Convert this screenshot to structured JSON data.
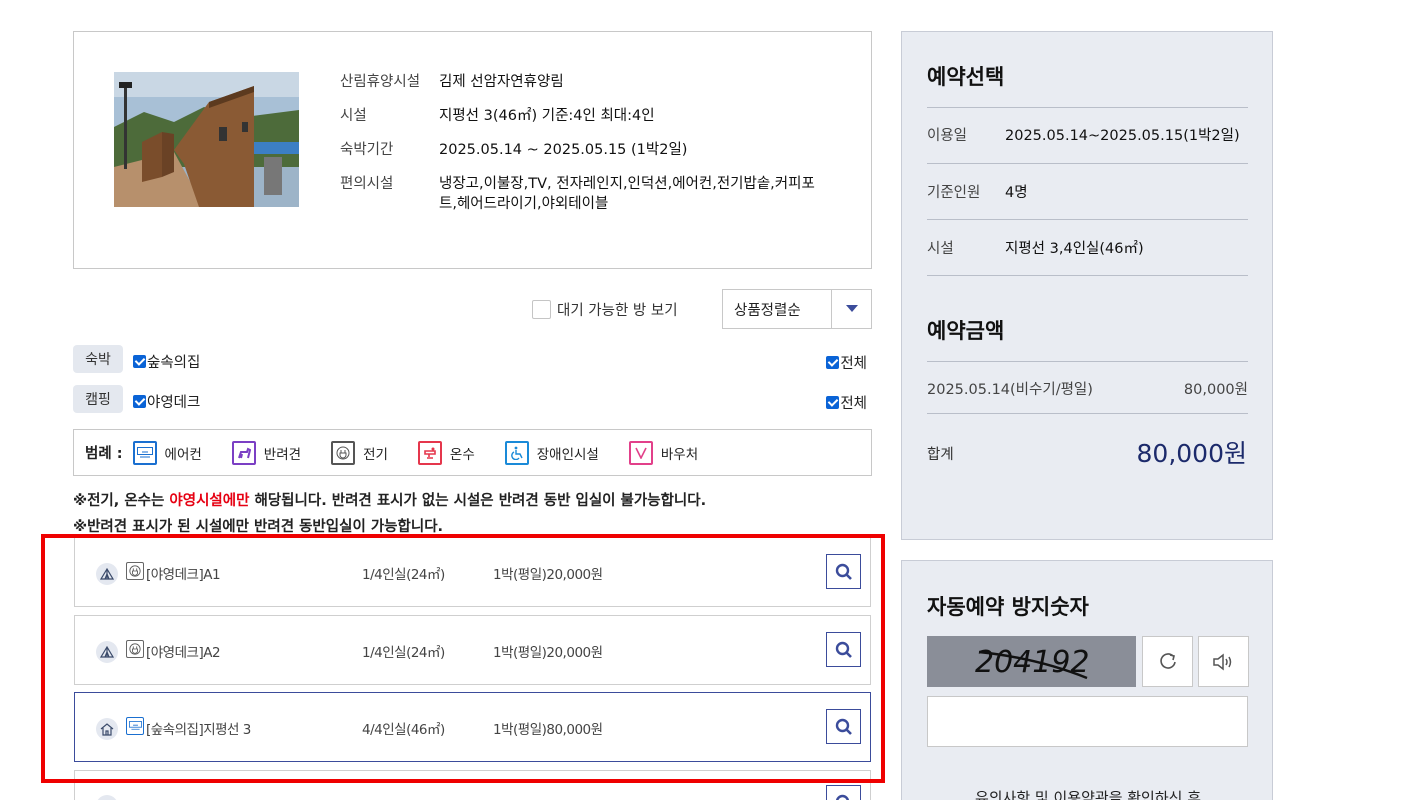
{
  "facility": {
    "rows": [
      {
        "label": "산림휴양시설",
        "value": "김제 선암자연휴양림"
      },
      {
        "label": "시설",
        "value": "지평선 3(46㎡) 기준:4인 최대:4인"
      },
      {
        "label": "숙박기간",
        "value": "2025.05.14 ~ 2025.05.15 (1박2일)"
      },
      {
        "label": "편의시설",
        "value": "냉장고,이불장,TV, 전자레인지,인덕션,에어컨,전기밥솥,커피포트,헤어드라이기,야외테이블"
      }
    ]
  },
  "toolbar": {
    "wait_label": "대기 가능한 방 보기",
    "sort_value": "상품정렬순"
  },
  "categories": [
    {
      "tag": "숙박",
      "option": "숲속의집",
      "all": "전체"
    },
    {
      "tag": "캠핑",
      "option": "야영데크",
      "all": "전체"
    }
  ],
  "legend": {
    "title": "범례 :",
    "items": [
      {
        "label": "에어컨",
        "icon": "aircon-icon",
        "color": "#1a6fd0"
      },
      {
        "label": "반려견",
        "icon": "pet-icon",
        "color": "#7b3fc4"
      },
      {
        "label": "전기",
        "icon": "electric-icon",
        "color": "#555555"
      },
      {
        "label": "온수",
        "icon": "hot-water-icon",
        "color": "#e5364c"
      },
      {
        "label": "장애인시설",
        "icon": "accessibility-icon",
        "color": "#1a8ad8"
      },
      {
        "label": "바우처",
        "icon": "voucher-icon",
        "color": "#e2408a"
      }
    ]
  },
  "notice": {
    "line1_prefix": "※전기, 온수는 ",
    "line1_red": "야영시설에만",
    "line1_suffix": " 해당됩니다. 반려견 표시가 없는 시설은 반려견 동반 입실이 불가능합니다.",
    "line2": "※반려견 표시가 된 시설에만 반려견 동반입실이 가능합니다."
  },
  "rooms": [
    {
      "name": "[야영데크]A1",
      "capacity": "1/4인실(24㎡)",
      "price": "1박(평일)20,000원",
      "type": "camping",
      "feature": "electric",
      "selected": false
    },
    {
      "name": "[야영데크]A2",
      "capacity": "1/4인실(24㎡)",
      "price": "1박(평일)20,000원",
      "type": "camping",
      "feature": "electric",
      "selected": false
    },
    {
      "name": "[숲속의집]지평선 3",
      "capacity": "4/4인실(46㎡)",
      "price": "1박(평일)80,000원",
      "type": "cabin",
      "feature": "aircon",
      "selected": true
    }
  ],
  "reservation": {
    "title": "예약선택",
    "rows": [
      {
        "label": "이용일",
        "value": "2025.05.14~2025.05.15(1박2일)"
      },
      {
        "label": "기준인원",
        "value": "4명"
      },
      {
        "label": "시설",
        "value": "지평선 3,4인실(46㎡)"
      }
    ],
    "amount_title": "예약금액",
    "amount_rows": [
      {
        "label": "2025.05.14(비수기/평일)",
        "value": "80,000원"
      }
    ],
    "total_label": "합계",
    "total_value": "80,000원"
  },
  "captcha": {
    "title": "자동예약 방지숫자",
    "code": "204192",
    "notice": "유의사항 및 이용약관을 확인하신 후"
  },
  "colors": {
    "accent": "#3b4c9b",
    "highlight": "#ef0000",
    "notice_red": "#e60012",
    "total": "#1c2a6b"
  }
}
